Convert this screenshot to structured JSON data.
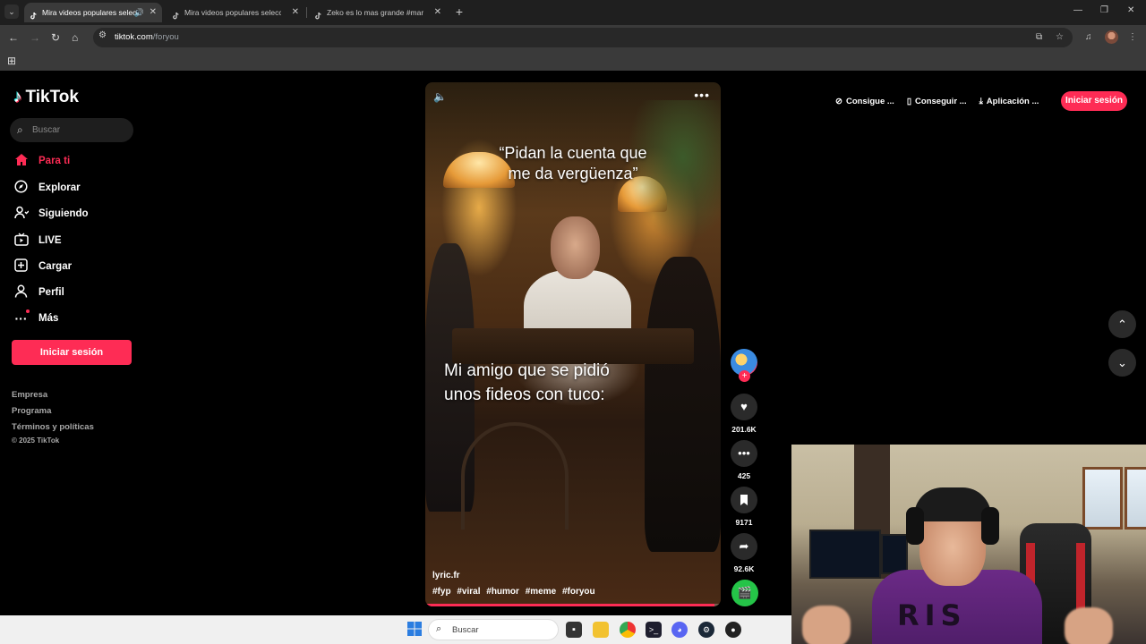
{
  "browser": {
    "tabs": [
      {
        "label": "Mira videos populares seleccionados",
        "active": true,
        "audio": true
      },
      {
        "label": "Mira videos populares seleccionados",
        "active": false,
        "audio": false
      },
      {
        "label": "Zeko es lo mas grande #margin",
        "active": false,
        "audio": false
      }
    ],
    "url_host": "tiktok.com",
    "url_path": "/foryou"
  },
  "tiktok": {
    "logo_text": "TikTok",
    "search_placeholder": "Buscar",
    "nav": [
      {
        "label": "Para ti",
        "icon": "home-icon",
        "active": true
      },
      {
        "label": "Explorar",
        "icon": "compass-icon",
        "active": false
      },
      {
        "label": "Siguiendo",
        "icon": "users-icon",
        "active": false
      },
      {
        "label": "LIVE",
        "icon": "live-tv-icon",
        "active": false
      },
      {
        "label": "Cargar",
        "icon": "upload-icon",
        "active": false
      },
      {
        "label": "Perfil",
        "icon": "profile-icon",
        "active": false
      },
      {
        "label": "Más",
        "icon": "more-dots-icon",
        "active": false
      }
    ],
    "login_label": "Iniciar sesión",
    "footer_links": [
      "Empresa",
      "Programa",
      "Términos y políticas"
    ],
    "copyright": "© 2025 TikTok",
    "top_actions": [
      {
        "label": "Consigue ...",
        "icon": "coin-icon"
      },
      {
        "label": "Conseguir ...",
        "icon": "phone-icon"
      },
      {
        "label": "Aplicación ...",
        "icon": "download-icon"
      }
    ],
    "top_login_label": "Iniciar sesión",
    "video": {
      "quote_line1": "“Pidan la cuenta que",
      "quote_line2": "me da vergüenza”",
      "caption_line1": "Mi amigo que se pidió",
      "caption_line2": "unos fideos con tuco:",
      "author": "lyric.fr",
      "hashtags": [
        "#fyp",
        "#viral",
        "#humor",
        "#meme",
        "#foryou"
      ],
      "progress": 0.98
    },
    "actions": {
      "likes": "201.6K",
      "comments": "425",
      "saves": "9171",
      "shares": "92.6K"
    }
  },
  "webcam": {
    "shirt_text": "RIS"
  },
  "taskbar": {
    "search_label": "Buscar"
  },
  "colors": {
    "brand": "#fe2c55",
    "cyan": "#25f4ee",
    "music_disc": "#25c448"
  }
}
